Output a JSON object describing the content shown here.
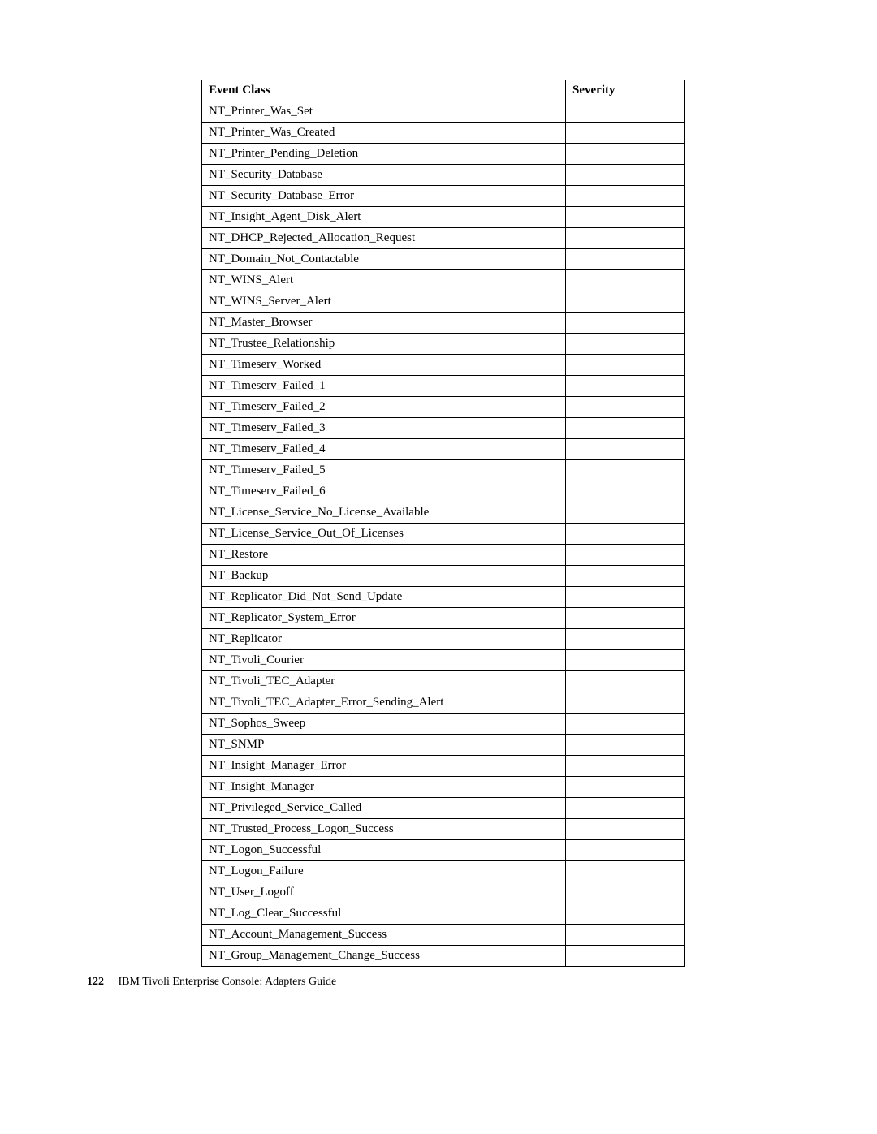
{
  "table": {
    "headers": {
      "event_class": "Event Class",
      "severity": "Severity"
    },
    "rows": [
      {
        "event_class": "NT_Printer_Was_Set",
        "severity": ""
      },
      {
        "event_class": "NT_Printer_Was_Created",
        "severity": ""
      },
      {
        "event_class": "NT_Printer_Pending_Deletion",
        "severity": ""
      },
      {
        "event_class": "NT_Security_Database",
        "severity": ""
      },
      {
        "event_class": "NT_Security_Database_Error",
        "severity": ""
      },
      {
        "event_class": "NT_Insight_Agent_Disk_Alert",
        "severity": ""
      },
      {
        "event_class": "NT_DHCP_Rejected_Allocation_Request",
        "severity": ""
      },
      {
        "event_class": "NT_Domain_Not_Contactable",
        "severity": ""
      },
      {
        "event_class": "NT_WINS_Alert",
        "severity": ""
      },
      {
        "event_class": "NT_WINS_Server_Alert",
        "severity": ""
      },
      {
        "event_class": "NT_Master_Browser",
        "severity": ""
      },
      {
        "event_class": "NT_Trustee_Relationship",
        "severity": ""
      },
      {
        "event_class": "NT_Timeserv_Worked",
        "severity": ""
      },
      {
        "event_class": "NT_Timeserv_Failed_1",
        "severity": ""
      },
      {
        "event_class": "NT_Timeserv_Failed_2",
        "severity": ""
      },
      {
        "event_class": "NT_Timeserv_Failed_3",
        "severity": ""
      },
      {
        "event_class": "NT_Timeserv_Failed_4",
        "severity": ""
      },
      {
        "event_class": "NT_Timeserv_Failed_5",
        "severity": ""
      },
      {
        "event_class": "NT_Timeserv_Failed_6",
        "severity": ""
      },
      {
        "event_class": "NT_License_Service_No_License_Available",
        "severity": ""
      },
      {
        "event_class": "NT_License_Service_Out_Of_Licenses",
        "severity": ""
      },
      {
        "event_class": "NT_Restore",
        "severity": ""
      },
      {
        "event_class": "NT_Backup",
        "severity": ""
      },
      {
        "event_class": "NT_Replicator_Did_Not_Send_Update",
        "severity": ""
      },
      {
        "event_class": "NT_Replicator_System_Error",
        "severity": ""
      },
      {
        "event_class": "NT_Replicator",
        "severity": ""
      },
      {
        "event_class": "NT_Tivoli_Courier",
        "severity": ""
      },
      {
        "event_class": "NT_Tivoli_TEC_Adapter",
        "severity": ""
      },
      {
        "event_class": "NT_Tivoli_TEC_Adapter_Error_Sending_Alert",
        "severity": ""
      },
      {
        "event_class": "NT_Sophos_Sweep",
        "severity": ""
      },
      {
        "event_class": "NT_SNMP",
        "severity": ""
      },
      {
        "event_class": "NT_Insight_Manager_Error",
        "severity": ""
      },
      {
        "event_class": "NT_Insight_Manager",
        "severity": ""
      },
      {
        "event_class": "NT_Privileged_Service_Called",
        "severity": ""
      },
      {
        "event_class": "NT_Trusted_Process_Logon_Success",
        "severity": ""
      },
      {
        "event_class": "NT_Logon_Successful",
        "severity": ""
      },
      {
        "event_class": "NT_Logon_Failure",
        "severity": ""
      },
      {
        "event_class": "NT_User_Logoff",
        "severity": ""
      },
      {
        "event_class": "NT_Log_Clear_Successful",
        "severity": ""
      },
      {
        "event_class": "NT_Account_Management_Success",
        "severity": ""
      },
      {
        "event_class": "NT_Group_Management_Change_Success",
        "severity": ""
      }
    ]
  },
  "footer": {
    "page_number": "122",
    "text": "IBM Tivoli Enterprise Console: Adapters Guide"
  }
}
